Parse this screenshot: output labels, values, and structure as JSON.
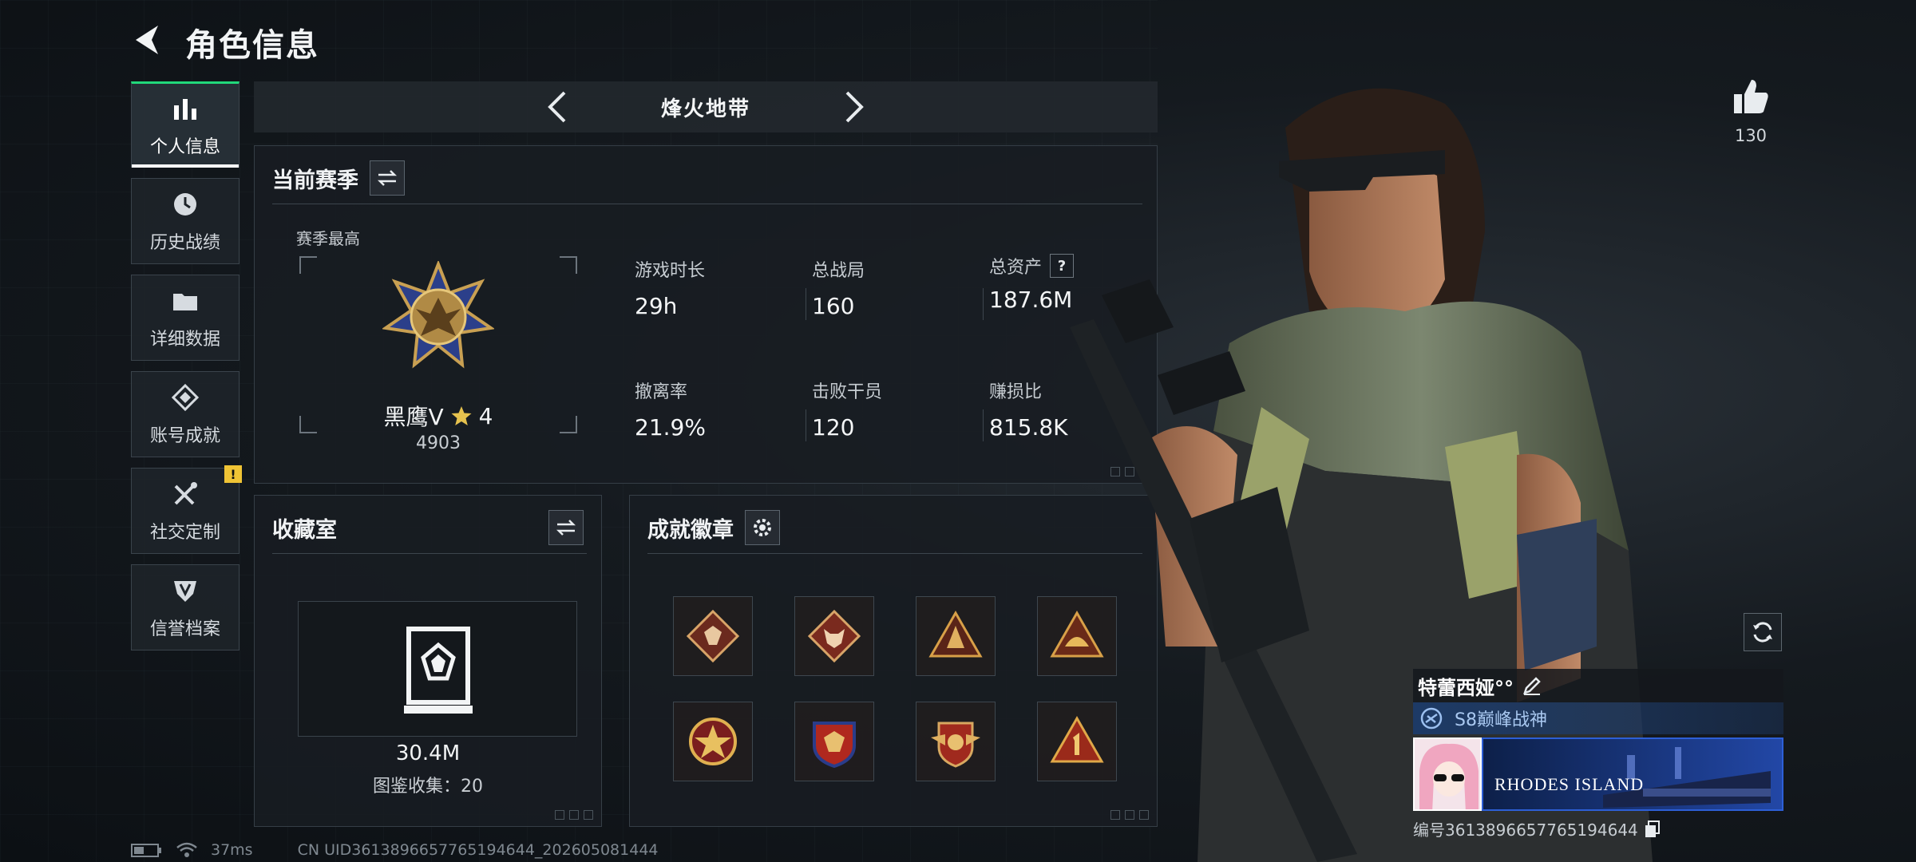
{
  "header": {
    "title": "角色信息"
  },
  "sidenav": {
    "items": [
      {
        "label": "个人信息",
        "icon": "bar-chart-icon",
        "active": true
      },
      {
        "label": "历史战绩",
        "icon": "clock-icon"
      },
      {
        "label": "详细数据",
        "icon": "folder-icon"
      },
      {
        "label": "账号成就",
        "icon": "diamond-badge-icon"
      },
      {
        "label": "社交定制",
        "icon": "tools-icon",
        "badge": "!"
      },
      {
        "label": "信誉档案",
        "icon": "shield-icon"
      }
    ]
  },
  "mode_selector": {
    "title": "烽火地带"
  },
  "season": {
    "title": "当前赛季",
    "best_label": "赛季最高",
    "rank_name": "黑鹰V",
    "rank_stars": "4",
    "rank_score": "4903",
    "stats": [
      {
        "label": "游戏时长",
        "value": "29h"
      },
      {
        "label": "总战局",
        "value": "160"
      },
      {
        "label": "总资产",
        "value": "187.6M",
        "help": "?"
      },
      {
        "label": "撤离率",
        "value": "21.9%"
      },
      {
        "label": "击败干员",
        "value": "120"
      },
      {
        "label": "赚损比",
        "value": "815.8K"
      }
    ]
  },
  "collection": {
    "title": "收藏室",
    "value": "30.4M",
    "count_text": "图鉴收集：20"
  },
  "achievements": {
    "title": "成就徽章",
    "badges": [
      "dragon-diamond-badge",
      "wolf-diamond-badge",
      "triangle-gold-badge",
      "triangle-dome-badge",
      "star-round-badge",
      "red-shield-badge",
      "wing-shield-badge",
      "number-one-triangle-badge"
    ]
  },
  "likes": {
    "count": "130"
  },
  "namecard": {
    "name": "特蕾西娅°°",
    "title": "S8巅峰战神",
    "banner_text": "RHODES ISLAND",
    "uid": "编号3613896657765194644"
  },
  "status_bar": {
    "ping": "37ms",
    "uid_line": "CN UID3613896657765194644_202605081444"
  },
  "colors": {
    "accent_green": "#21d87a",
    "notice_yellow": "#f0c435",
    "namecard_blue": "#2247a6"
  }
}
